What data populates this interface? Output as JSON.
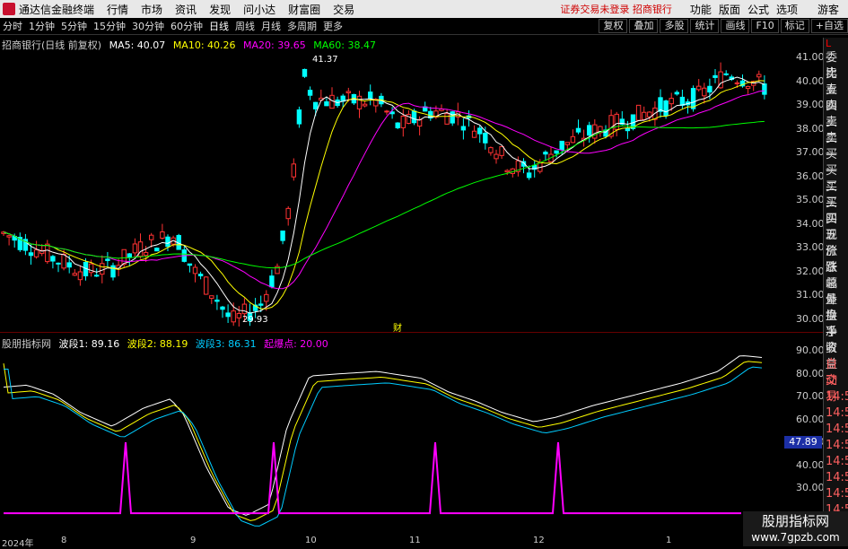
{
  "app": {
    "title": "通达信金融终端",
    "menus": [
      "行情",
      "市场",
      "资讯",
      "发现",
      "问小达",
      "财富圈",
      "交易"
    ],
    "warn": "证券交易未登录",
    "bank": "招商银行",
    "right": [
      "功能",
      "版面",
      "公式",
      "选项"
    ],
    "guest": "游客"
  },
  "tabs": [
    "分时",
    "1分钟",
    "5分钟",
    "15分钟",
    "30分钟",
    "60分钟",
    "日线",
    "周线",
    "月线",
    "多周期",
    "更多"
  ],
  "tools": [
    "复权",
    "叠加",
    "多股",
    "统计",
    "画线",
    "F10",
    "标记",
    "+自选"
  ],
  "info": {
    "stock": "招商银行(日线 前复权)",
    "ma5": "MA5: 40.07",
    "ma10": "MA10: 40.26",
    "ma20": "MA20: 39.65",
    "ma60": "MA60: 38.47"
  },
  "sub": {
    "name": "股朋指标网",
    "b1": "波段1: 89.16",
    "b2": "波段2: 88.19",
    "b3": "波段3: 86.31",
    "qbd": "起爆点: 20.00"
  },
  "price_axis": [
    "41.00",
    "40.00",
    "39.00",
    "38.00",
    "37.00",
    "36.00",
    "35.00",
    "34.00",
    "33.00",
    "32.00",
    "31.00",
    "30.00"
  ],
  "sub_axis": [
    "90.00",
    "80.00",
    "70.00",
    "60.00",
    "50.00",
    "40.00",
    "30.00"
  ],
  "cursor_value": "47.89",
  "hi_label": "41.37",
  "lo_label": "29.93",
  "cai": "财",
  "right_labels": [
    "委比",
    "卖五",
    "卖四",
    "卖三",
    "卖二",
    "卖一",
    "买一",
    "买二",
    "买三",
    "买四",
    "买五",
    "现价",
    "涨跌",
    "涨幅",
    "总量",
    "外盘",
    "换手",
    "净资",
    "收益",
    "自动",
    "交易",
    "14:56",
    "14:56",
    "14:56",
    "14:56",
    "14:56",
    "14:56",
    "14:56",
    "14:56"
  ],
  "lbox": "L",
  "year": "2024年",
  "xaxis": [
    {
      "t": "8"
    },
    {
      "t": "9"
    },
    {
      "t": "10"
    },
    {
      "t": "11"
    },
    {
      "t": "12"
    },
    {
      "t": "1"
    }
  ],
  "watermark": {
    "line1": "股朋指标网",
    "line2": "www.7gpzb.com"
  },
  "colors": {
    "up": "#ff3232",
    "down": "#00ffff",
    "ma5": "#ffffff",
    "ma10": "#ffff00",
    "ma20": "#ff00ff",
    "ma60": "#00ff00",
    "spike": "#ff00ff"
  }
}
